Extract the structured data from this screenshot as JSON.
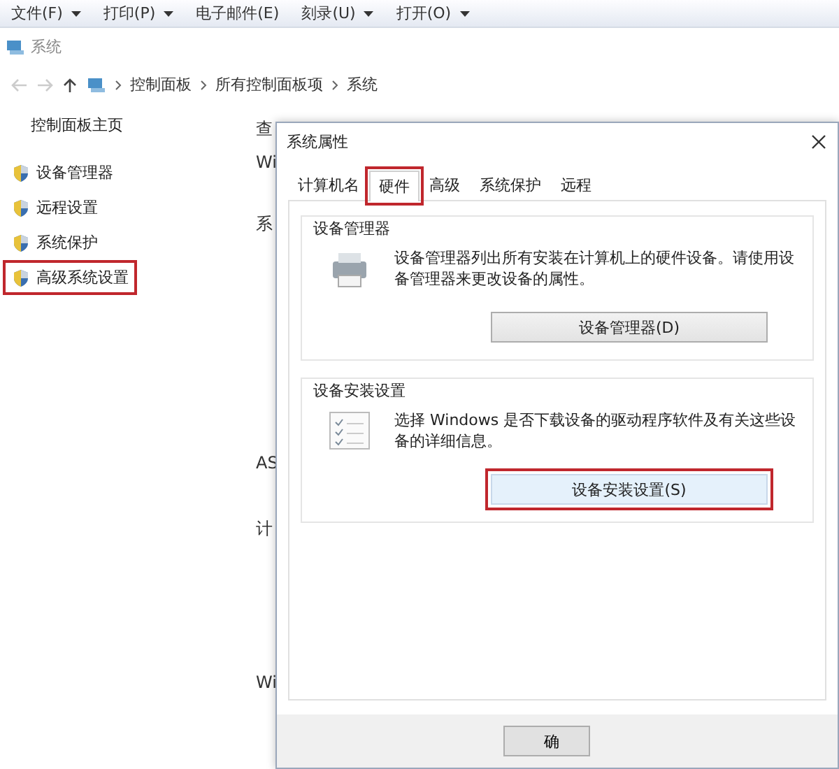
{
  "menu_bar": [
    {
      "label": "文件(F)",
      "dropdown": true
    },
    {
      "label": "打印(P)",
      "dropdown": true
    },
    {
      "label": "电子邮件(E)",
      "dropdown": false
    },
    {
      "label": "刻录(U)",
      "dropdown": true
    },
    {
      "label": "打开(O)",
      "dropdown": true
    }
  ],
  "window": {
    "title": "系统"
  },
  "address_bar": {
    "path": [
      "控制面板",
      "所有控制面板项",
      "系统"
    ]
  },
  "sidebar": {
    "home": "控制面板主页",
    "items": [
      {
        "label": "设备管理器",
        "highlighted": false
      },
      {
        "label": "远程设置",
        "highlighted": false
      },
      {
        "label": "系统保护",
        "highlighted": false
      },
      {
        "label": "高级系统设置",
        "highlighted": true
      }
    ]
  },
  "main_fragments": [
    "查",
    "Wi",
    "系",
    "AS",
    "计",
    "Wi"
  ],
  "dialog": {
    "title": "系统属性",
    "tabs": [
      {
        "label": "计算机名",
        "selected": false,
        "highlighted": false
      },
      {
        "label": "硬件",
        "selected": true,
        "highlighted": true
      },
      {
        "label": "高级",
        "selected": false,
        "highlighted": false
      },
      {
        "label": "系统保护",
        "selected": false,
        "highlighted": false
      },
      {
        "label": "远程",
        "selected": false,
        "highlighted": false
      }
    ],
    "groups": [
      {
        "kind": "devices",
        "title": "设备管理器",
        "text": "设备管理器列出所有安装在计算机上的硬件设备。请使用设备管理器来更改设备的属性。",
        "button": {
          "label": "设备管理器(D)",
          "highlighted": false
        }
      },
      {
        "kind": "install",
        "title": "设备安装设置",
        "text": "选择 Windows 是否下载设备的驱动程序软件及有关这些设备的详细信息。",
        "button": {
          "label": "设备安装设置(S)",
          "highlighted": true
        }
      }
    ],
    "footer_buttons": [
      "确"
    ]
  }
}
